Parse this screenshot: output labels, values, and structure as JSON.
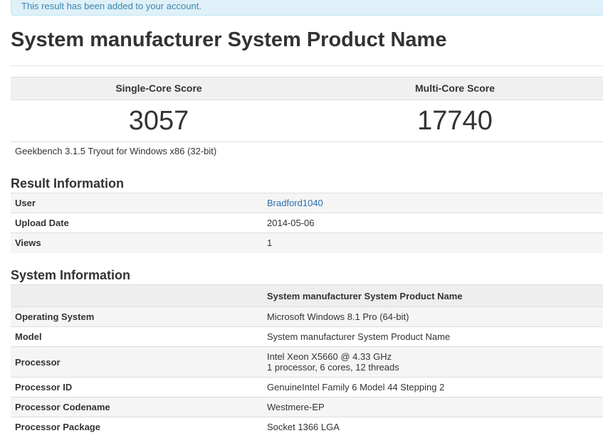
{
  "alert": {
    "text": "This result has been added to your account."
  },
  "page_title": "System manufacturer System Product Name",
  "scores": {
    "single_label": "Single-Core Score",
    "multi_label": "Multi-Core Score",
    "single_value": "3057",
    "multi_value": "17740"
  },
  "version_text": "Geekbench 3.1.5 Tryout for Windows x86 (32-bit)",
  "result_info": {
    "title": "Result Information",
    "rows": [
      {
        "label": "User",
        "value": "Bradford1040"
      },
      {
        "label": "Upload Date",
        "value": "2014-05-06"
      },
      {
        "label": "Views",
        "value": "1"
      }
    ]
  },
  "system_info": {
    "title": "System Information",
    "header": "System manufacturer System Product Name",
    "rows": [
      {
        "label": "Operating System",
        "value": "Microsoft Windows 8.1 Pro (64-bit)"
      },
      {
        "label": "Model",
        "value": "System manufacturer System Product Name"
      },
      {
        "label": "Processor",
        "value": "Intel Xeon X5660 @ 4.33 GHz",
        "value2": "1 processor, 6 cores, 12 threads"
      },
      {
        "label": "Processor ID",
        "value": "GenuineIntel Family 6 Model 44 Stepping 2"
      },
      {
        "label": "Processor Codename",
        "value": "Westmere-EP"
      },
      {
        "label": "Processor Package",
        "value": "Socket 1366 LGA"
      }
    ]
  },
  "colors": {
    "link": "#2a6fb0",
    "alert_bg": "#dff0f8",
    "alert_text": "#3a87ad"
  }
}
